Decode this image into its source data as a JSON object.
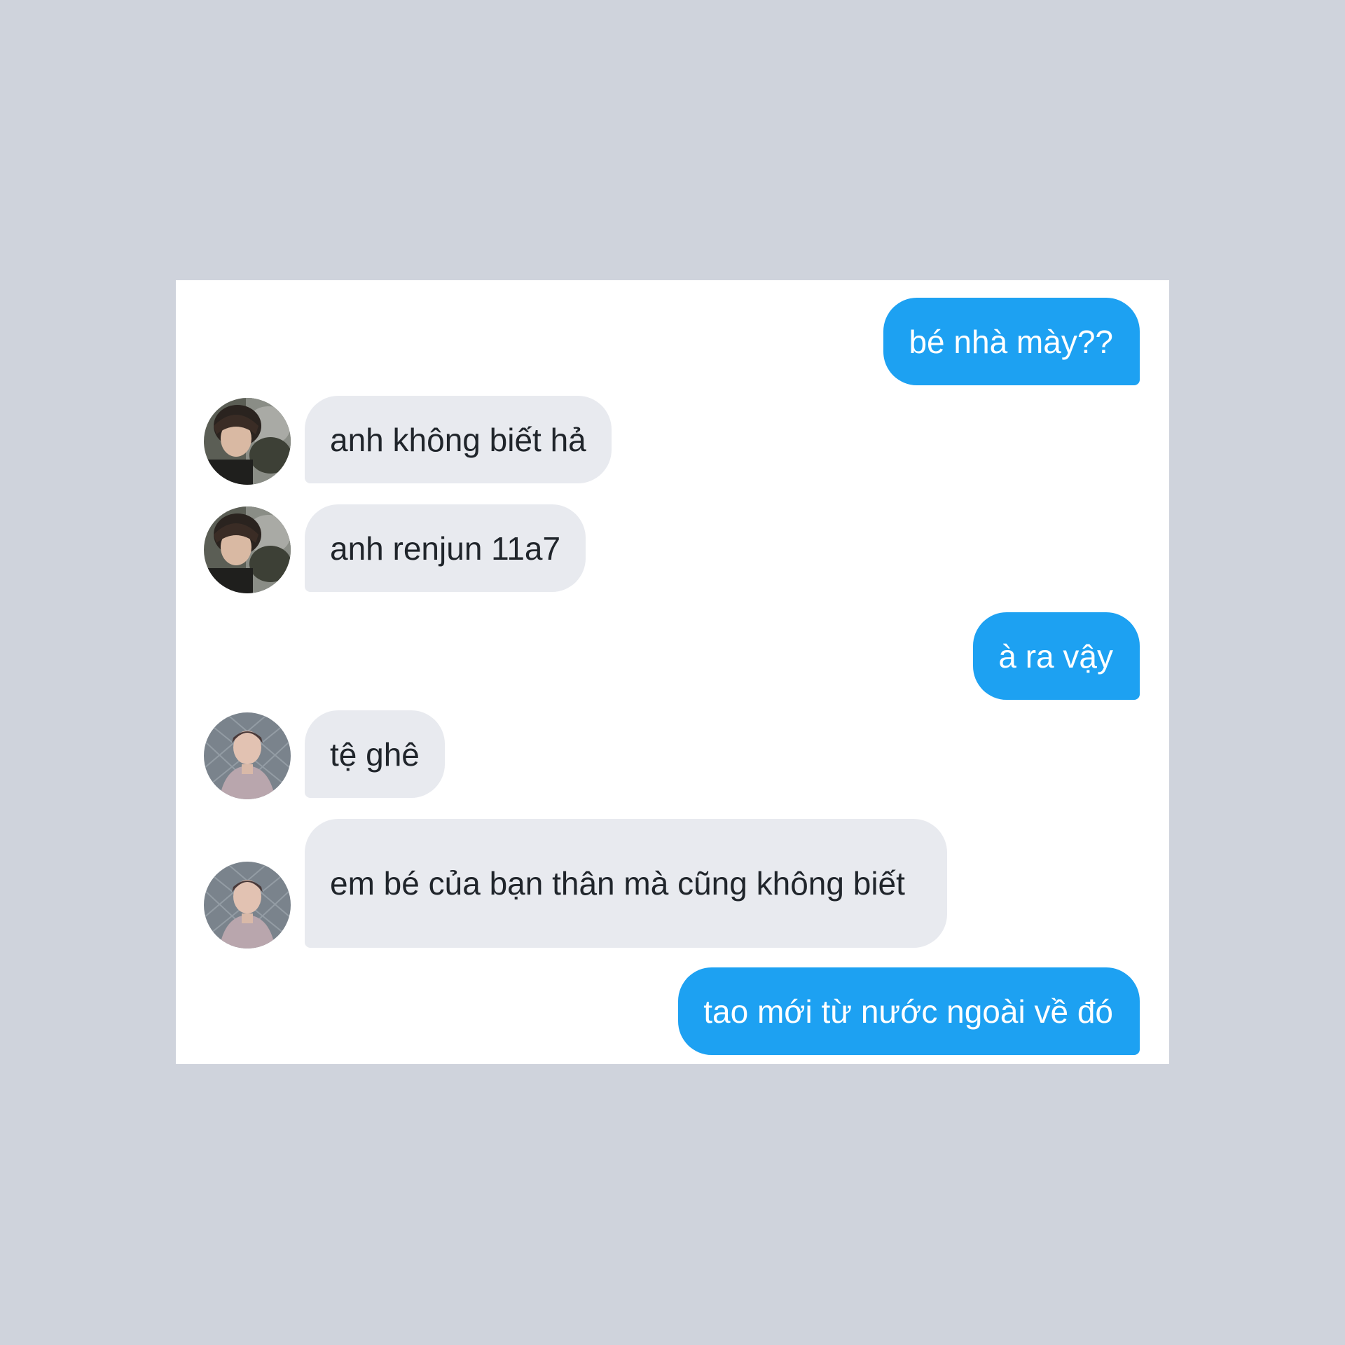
{
  "conversation": {
    "messages": [
      {
        "side": "out",
        "text": "bé nhà mày??"
      },
      {
        "side": "in",
        "avatar": "avatar-photo-dark",
        "text": "anh không biết hả"
      },
      {
        "side": "in",
        "avatar": "avatar-photo-dark",
        "text": "anh renjun 11a7"
      },
      {
        "side": "out",
        "text": "à ra vậy"
      },
      {
        "side": "in",
        "avatar": "avatar-photo-fence",
        "text": "tệ ghê"
      },
      {
        "side": "in",
        "avatar": "avatar-photo-fence",
        "text": "em bé của bạn thân mà cũng không biết"
      },
      {
        "side": "out",
        "text": "tao mới từ nước ngoài về đó"
      }
    ]
  },
  "colors": {
    "background": "#cfd3dc",
    "card": "#ffffff",
    "outgoing_bubble": "#1da1f2",
    "incoming_bubble": "#e8eaef",
    "incoming_text": "#20252b",
    "outgoing_text": "#ffffff"
  }
}
